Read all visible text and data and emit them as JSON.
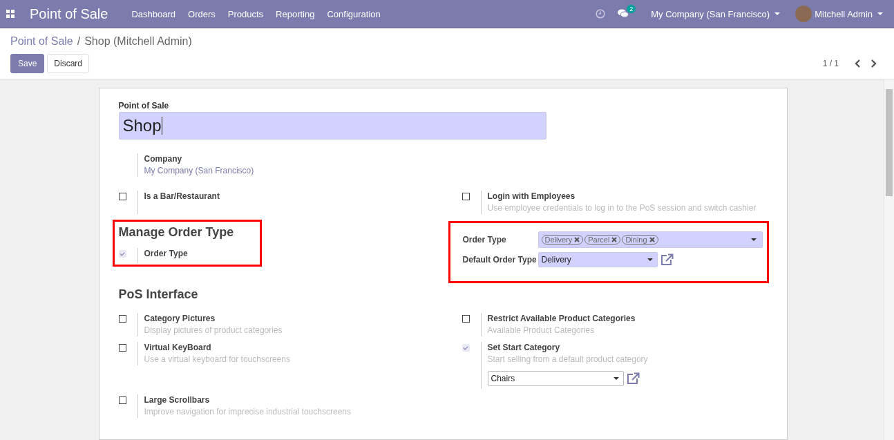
{
  "navbar": {
    "app_title": "Point of Sale",
    "menu": [
      "Dashboard",
      "Orders",
      "Products",
      "Reporting",
      "Configuration"
    ],
    "message_count": "2",
    "company": "My Company (San Francisco)",
    "user": "Mitchell Admin"
  },
  "breadcrumb": {
    "parent": "Point of Sale",
    "separator": "/",
    "current": "Shop (Mitchell Admin)"
  },
  "buttons": {
    "save": "Save",
    "discard": "Discard"
  },
  "pager": "1 / 1",
  "form": {
    "name_label": "Point of Sale",
    "name_value": "Shop",
    "company": {
      "label": "Company",
      "value": "My Company (San Francisco)"
    },
    "top_settings": [
      {
        "label": "Is a Bar/Restaurant",
        "checked": false
      },
      {
        "label": "Login with Employees",
        "description": "Use employee credentials to log in to the PoS session and switch cashier",
        "checked": false
      }
    ],
    "order_section": {
      "title": "Manage Order Type",
      "setting": {
        "label": "Order Type",
        "checked": true
      },
      "order_type_label": "Order Type",
      "order_types": [
        "Delivery",
        "Parcel",
        "Dining"
      ],
      "default_label": "Default Order Type",
      "default_value": "Delivery"
    },
    "interface_title": "PoS Interface",
    "interface_settings": [
      {
        "label": "Category Pictures",
        "description": "Display pictures of product categories",
        "checked": false
      },
      {
        "label": "Restrict Available Product Categories",
        "description": "Available Product Categories",
        "checked": false
      },
      {
        "label": "Virtual KeyBoard",
        "description": "Use a virtual keyboard for touchscreens",
        "checked": false
      },
      {
        "label": "Set Start Category",
        "description": "Start selling from a default product category",
        "checked": true,
        "select_value": "Chairs"
      },
      {
        "label": "Large Scrollbars",
        "description": "Improve navigation for imprecise industrial touchscreens",
        "checked": false
      }
    ]
  }
}
